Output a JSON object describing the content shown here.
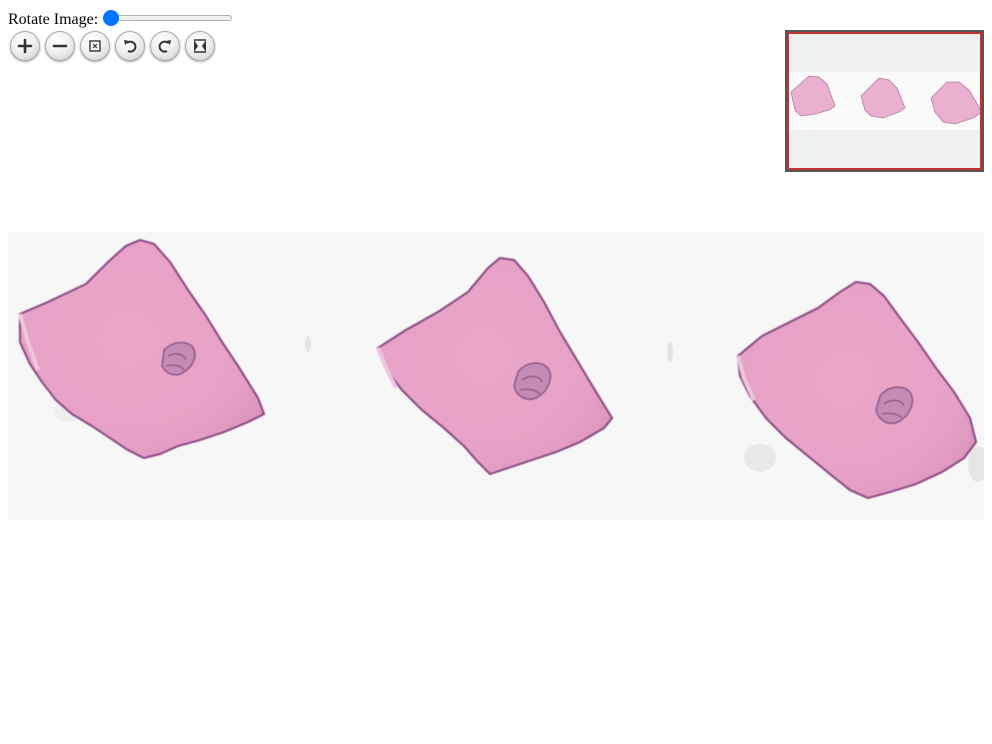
{
  "rotate": {
    "label": "Rotate Image:",
    "value_fraction": 0
  },
  "toolbar": {
    "buttons": [
      {
        "name": "zoom-in-button",
        "icon": "plus-icon"
      },
      {
        "name": "zoom-out-button",
        "icon": "minus-icon"
      },
      {
        "name": "home-button",
        "icon": "home-icon"
      },
      {
        "name": "rotate-left-button",
        "icon": "rotate-left-icon"
      },
      {
        "name": "rotate-right-button",
        "icon": "rotate-right-icon"
      },
      {
        "name": "fullpage-button",
        "icon": "fullscreen-icon"
      }
    ]
  },
  "colors": {
    "slider_accent": "#0075ff",
    "tissue": "#e8a6c8",
    "tissue_edge": "#8e4b86",
    "navigator_region": "#c03434",
    "background": "#f7f7f7"
  }
}
